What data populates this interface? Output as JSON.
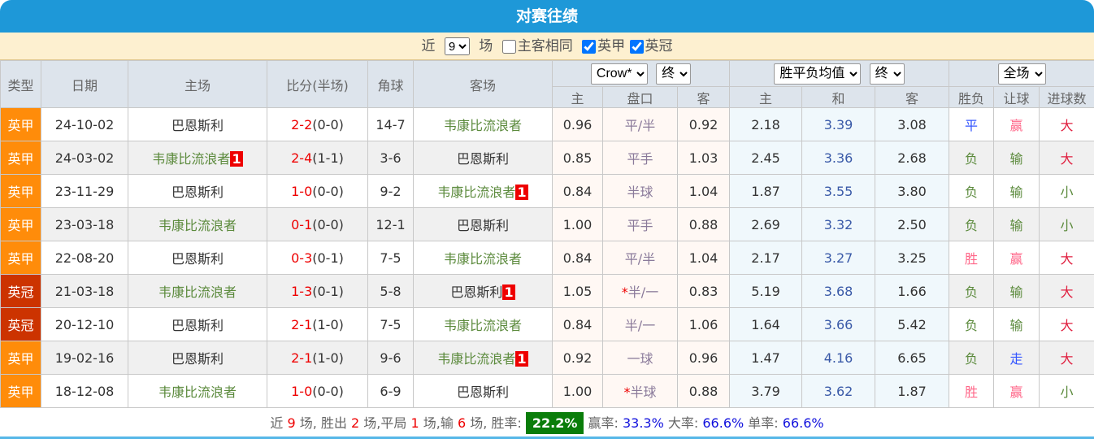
{
  "title": "对赛往绩",
  "filter": {
    "recent": "近",
    "count": "9",
    "unit": "场",
    "same_home": "主客相同",
    "same_home_checked": false,
    "leagues": [
      {
        "label": "英甲",
        "checked": true
      },
      {
        "label": "英冠",
        "checked": true
      }
    ]
  },
  "headers": {
    "type": "类型",
    "date": "日期",
    "home": "主场",
    "score": "比分(半场)",
    "corner": "角球",
    "away": "客场",
    "company": "Crow*",
    "company_state": "终",
    "euro": "胜平负均值",
    "euro_state": "终",
    "period": "全场",
    "sub": [
      "主",
      "盘口",
      "客",
      "主",
      "和",
      "客",
      "胜负",
      "让球",
      "进球数"
    ]
  },
  "colors": {
    "title": "#1e98d8",
    "league1": "#ff8c0a",
    "league_champ": "#cc3300",
    "win": "#ff6688",
    "loss": "#5b8a3c",
    "draw": "#3355ff"
  },
  "rows": [
    {
      "type": "英甲",
      "date": "24-10-02",
      "home": "巴恩斯利",
      "home_badge": "",
      "score": "2-2",
      "half": "(0-0)",
      "corner": "14-7",
      "away": "韦康比流浪者",
      "away_badge": "",
      "o1": "0.96",
      "hc": "平/半",
      "o2": "0.92",
      "e1": "2.18",
      "e2": "3.39",
      "e3": "3.08",
      "r": "平",
      "ah": "赢",
      "ou": "大"
    },
    {
      "type": "英甲",
      "date": "24-03-02",
      "home": "韦康比流浪者",
      "home_badge": "1",
      "score": "2-4",
      "half": "(1-1)",
      "corner": "3-6",
      "away": "巴恩斯利",
      "away_badge": "",
      "o1": "0.85",
      "hc": "平手",
      "o2": "1.03",
      "e1": "2.45",
      "e2": "3.36",
      "e3": "2.68",
      "r": "负",
      "ah": "输",
      "ou": "大"
    },
    {
      "type": "英甲",
      "date": "23-11-29",
      "home": "巴恩斯利",
      "home_badge": "",
      "score": "1-0",
      "half": "(0-0)",
      "corner": "9-2",
      "away": "韦康比流浪者",
      "away_badge": "1",
      "o1": "0.84",
      "hc": "半球",
      "o2": "1.04",
      "e1": "1.87",
      "e2": "3.55",
      "e3": "3.80",
      "r": "负",
      "ah": "输",
      "ou": "小"
    },
    {
      "type": "英甲",
      "date": "23-03-18",
      "home": "韦康比流浪者",
      "home_badge": "",
      "score": "0-1",
      "half": "(0-0)",
      "corner": "12-1",
      "away": "巴恩斯利",
      "away_badge": "",
      "o1": "1.00",
      "hc": "平手",
      "o2": "0.88",
      "e1": "2.69",
      "e2": "3.32",
      "e3": "2.50",
      "r": "负",
      "ah": "输",
      "ou": "小"
    },
    {
      "type": "英甲",
      "date": "22-08-20",
      "home": "巴恩斯利",
      "home_badge": "",
      "score": "0-3",
      "half": "(0-1)",
      "corner": "7-5",
      "away": "韦康比流浪者",
      "away_badge": "",
      "o1": "0.84",
      "hc": "平/半",
      "o2": "1.04",
      "e1": "2.17",
      "e2": "3.27",
      "e3": "3.25",
      "r": "胜",
      "ah": "赢",
      "ou": "大"
    },
    {
      "type": "英冠",
      "date": "21-03-18",
      "home": "韦康比流浪者",
      "home_badge": "",
      "score": "1-3",
      "half": "(0-1)",
      "corner": "5-8",
      "away": "巴恩斯利",
      "away_badge": "1",
      "o1": "1.05",
      "hc_star": "*",
      "hc": "半/一",
      "o2": "0.83",
      "e1": "5.19",
      "e2": "3.68",
      "e3": "1.66",
      "r": "负",
      "ah": "输",
      "ou": "大"
    },
    {
      "type": "英冠",
      "date": "20-12-10",
      "home": "巴恩斯利",
      "home_badge": "",
      "score": "2-1",
      "half": "(1-0)",
      "corner": "7-5",
      "away": "韦康比流浪者",
      "away_badge": "",
      "o1": "0.84",
      "hc": "半/一",
      "o2": "1.06",
      "e1": "1.64",
      "e2": "3.66",
      "e3": "5.42",
      "r": "负",
      "ah": "输",
      "ou": "大"
    },
    {
      "type": "英甲",
      "date": "19-02-16",
      "home": "巴恩斯利",
      "home_badge": "",
      "score": "2-1",
      "half": "(1-0)",
      "corner": "9-6",
      "away": "韦康比流浪者",
      "away_badge": "1",
      "o1": "0.92",
      "hc": "一球",
      "o2": "0.96",
      "e1": "1.47",
      "e2": "4.16",
      "e3": "6.65",
      "r": "负",
      "ah": "走",
      "ou": "大"
    },
    {
      "type": "英甲",
      "date": "18-12-08",
      "home": "韦康比流浪者",
      "home_badge": "",
      "score": "1-0",
      "half": "(0-0)",
      "corner": "6-9",
      "away": "巴恩斯利",
      "away_badge": "",
      "o1": "1.00",
      "hc_star": "*",
      "hc": "半球",
      "o2": "0.88",
      "e1": "3.79",
      "e2": "3.62",
      "e3": "1.87",
      "r": "胜",
      "ah": "赢",
      "ou": "小"
    }
  ],
  "footer": {
    "t1": "近 ",
    "games": "9",
    "t2": " 场, 胜出 ",
    "wins": "2",
    "t3": " 场,平局 ",
    "draws": "1",
    "t4": " 场,输 ",
    "losses": "6",
    "t5": " 场, 胜率: ",
    "win_rate": "22.2%",
    "t6": " 赢率: ",
    "ah_rate": "33.3%",
    "t7": " 大率: ",
    "over_rate": "66.6%",
    "t8": " 单率: ",
    "odd_rate": "66.6%"
  }
}
